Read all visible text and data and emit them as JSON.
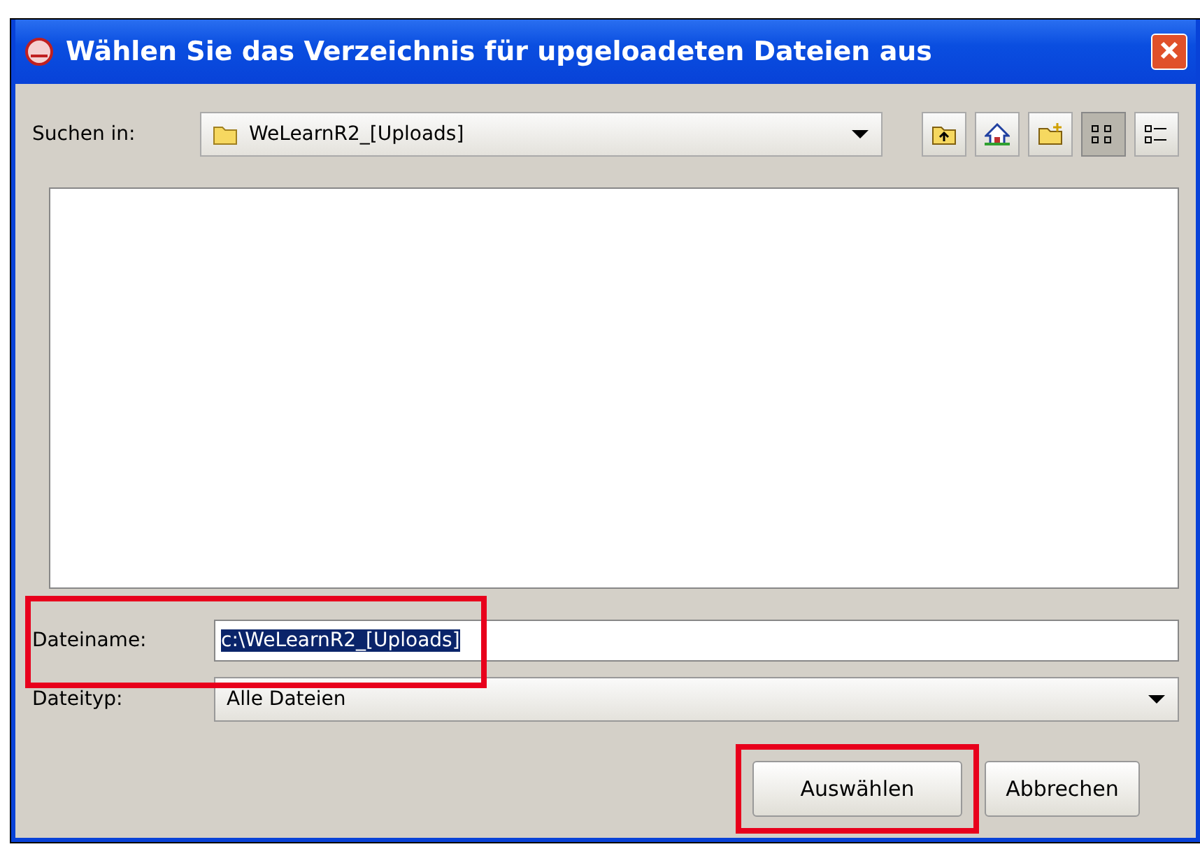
{
  "window": {
    "title": "Wählen Sie das Verzeichnis für upgeloadeten Dateien aus"
  },
  "look_in": {
    "label": "Suchen in:",
    "value": "WeLearnR2_[Uploads]"
  },
  "toolbar": [
    {
      "kind": "up",
      "selected": false
    },
    {
      "kind": "home",
      "selected": false
    },
    {
      "kind": "new-folder",
      "selected": false
    },
    {
      "kind": "list",
      "selected": true
    },
    {
      "kind": "details",
      "selected": false
    }
  ],
  "file_name": {
    "label": "Dateiname:",
    "value": "c:\\WeLearnR2_[Uploads]",
    "text_selected": true,
    "highlighted": true
  },
  "file_type": {
    "label": "Dateityp:",
    "value": "Alle Dateien"
  },
  "buttons": [
    {
      "label": "Auswählen",
      "highlighted": true
    },
    {
      "label": "Abbrechen",
      "highlighted": false
    }
  ]
}
